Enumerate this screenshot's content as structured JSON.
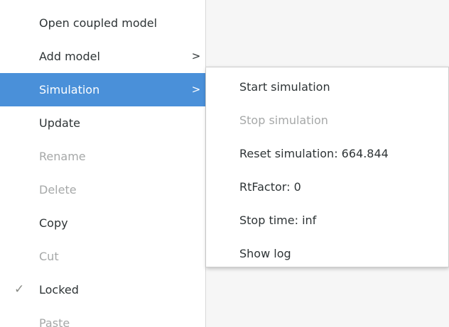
{
  "colors": {
    "active_bg": "#4a90d9",
    "active_text": "#ffffff",
    "disabled_text": "#a6a8a8",
    "text": "#2e3436",
    "background": "#f6f6f6"
  },
  "main_menu": {
    "items": [
      {
        "label": "Open coupled model",
        "disabled": false
      },
      {
        "label": "Add model",
        "disabled": false,
        "submenu_icon": "chevron-right-icon",
        "arrow": ">"
      },
      {
        "label": "Simulation",
        "disabled": false,
        "active": true,
        "submenu_icon": "chevron-right-icon",
        "arrow": ">"
      },
      {
        "label": "Update",
        "disabled": false
      },
      {
        "label": "Rename",
        "disabled": true
      },
      {
        "label": "Delete",
        "disabled": true
      },
      {
        "label": "Copy",
        "disabled": false
      },
      {
        "label": "Cut",
        "disabled": true
      },
      {
        "label": "Locked",
        "disabled": false,
        "checked": true,
        "check_icon": "checkmark-icon",
        "check": "✓"
      },
      {
        "label": "Paste",
        "disabled": true
      }
    ]
  },
  "simulation_submenu": {
    "items": [
      {
        "label": "Start simulation",
        "disabled": false
      },
      {
        "label": "Stop simulation",
        "disabled": true
      },
      {
        "label": "Reset simulation: 664.844",
        "disabled": false
      },
      {
        "label": "RtFactor: 0",
        "disabled": false
      },
      {
        "label": "Stop time: inf",
        "disabled": false
      },
      {
        "label": "Show log",
        "disabled": false
      }
    ]
  }
}
